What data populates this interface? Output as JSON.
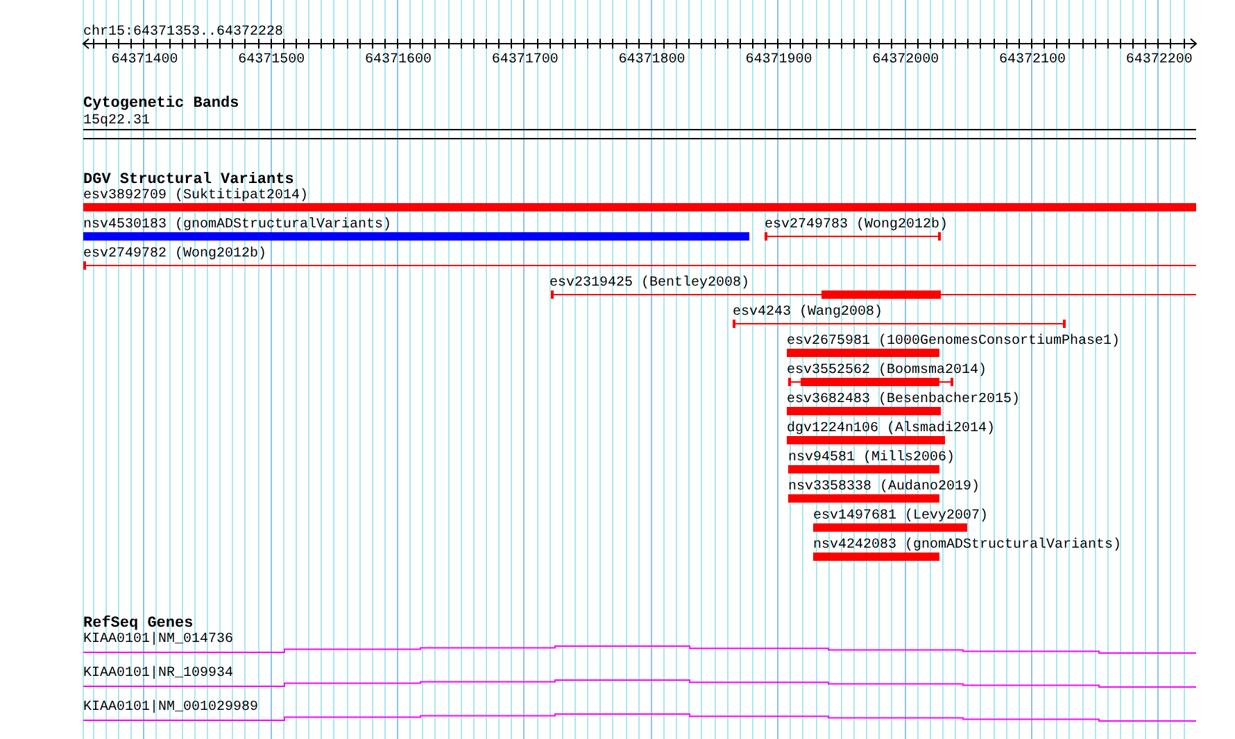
{
  "ruler": {
    "region": "chr15:64371353..64372228",
    "ticks": [
      "64371400",
      "64371500",
      "64371600",
      "64371700",
      "64371800",
      "64371900",
      "64372000",
      "64372100",
      "64372200"
    ]
  },
  "tracks": [
    {
      "title": "Cytogenetic Bands",
      "kind": "bands",
      "features": [
        {
          "label": "15q22.31",
          "kind": "band"
        }
      ]
    },
    {
      "title": "DGV Structural Variants",
      "kind": "variants",
      "features": [
        {
          "label": "esv3892709 (Suktitipat2014)",
          "kind": "bar",
          "color": "#ff0000"
        },
        {
          "label": "nsv4530183 (gnomADStructuralVariants)",
          "kind": "bar",
          "color": "#0000ff"
        },
        {
          "label": "esv2749783 (Wong2012b)",
          "kind": "interval",
          "color": "#ff0000"
        },
        {
          "label": "esv2749782 (Wong2012b)",
          "kind": "interval",
          "color": "#ff0000"
        },
        {
          "label": "esv2319425 (Bentley2008)",
          "kind": "interval_bar",
          "color": "#ff0000"
        },
        {
          "label": "esv4243 (Wang2008)",
          "kind": "interval",
          "color": "#ff0000"
        },
        {
          "label": "esv2675981 (1000GenomesConsortiumPhase1)",
          "kind": "bar",
          "color": "#ff0000"
        },
        {
          "label": "esv3552562 (Boomsma2014)",
          "kind": "interval_bar",
          "color": "#ff0000"
        },
        {
          "label": "esv3682483 (Besenbacher2015)",
          "kind": "bar",
          "color": "#ff0000"
        },
        {
          "label": "dgv1224n106 (Alsmadi2014)",
          "kind": "bar",
          "color": "#ff0000"
        },
        {
          "label": "nsv94581 (Mills2006)",
          "kind": "bar",
          "color": "#ff0000"
        },
        {
          "label": "nsv3358338 (Audano2019)",
          "kind": "bar",
          "color": "#ff0000"
        },
        {
          "label": "esv1497681 (Levy2007)",
          "kind": "bar",
          "color": "#ff0000"
        },
        {
          "label": "nsv4242083 (gnomADStructuralVariants)",
          "kind": "bar",
          "color": "#ff0000"
        }
      ]
    },
    {
      "title": "RefSeq Genes",
      "kind": "genes",
      "features": [
        {
          "label": "KIAA0101|NM_014736",
          "kind": "transcript"
        },
        {
          "label": "KIAA0101|NR_109934",
          "kind": "transcript"
        },
        {
          "label": "KIAA0101|NM_001029989",
          "kind": "transcript"
        }
      ]
    }
  ]
}
